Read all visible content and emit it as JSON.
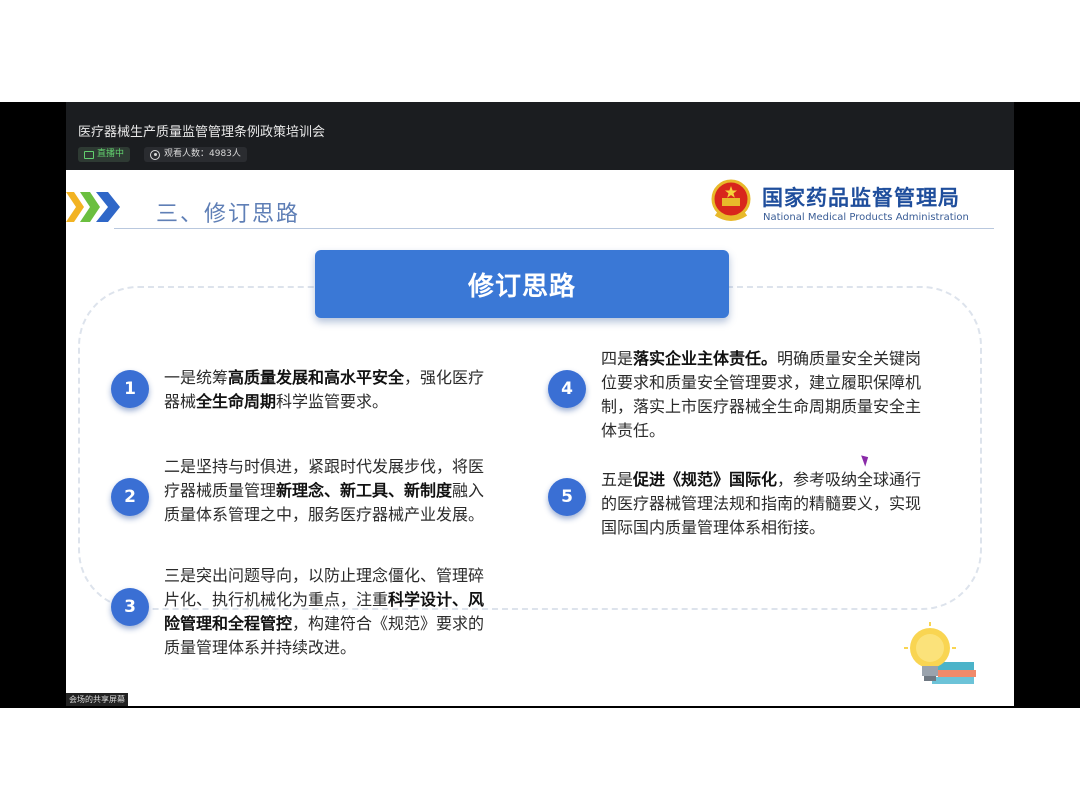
{
  "meeting": {
    "title": "医疗器械生产质量监管管理条例政策培训会",
    "live_label": "直播中",
    "viewers_label": "观看人数：4983人",
    "share_label": "会场的共享屏幕"
  },
  "slide": {
    "section_title": "三、修订思路",
    "logo_cn": "国家药品监督管理局",
    "logo_en": "National Medical Products Administration",
    "banner": "修订思路",
    "items": [
      {
        "num": "1",
        "segments": [
          {
            "t": "一是统筹",
            "b": false
          },
          {
            "t": "高质量发展和高水平安全",
            "b": true
          },
          {
            "t": "，强化医疗器械",
            "b": false
          },
          {
            "t": "全生命周期",
            "b": true
          },
          {
            "t": "科学监管要求。",
            "b": false
          }
        ]
      },
      {
        "num": "2",
        "segments": [
          {
            "t": "二是坚持与时俱进，紧跟时代发展步伐，将医疗器械质量管理",
            "b": false
          },
          {
            "t": "新理念、新工具、新制度",
            "b": true
          },
          {
            "t": "融入质量体系管理之中，服务医疗器械产业发展。",
            "b": false
          }
        ]
      },
      {
        "num": "3",
        "segments": [
          {
            "t": "三是突出问题导向，以防止理念僵化、管理碎片化、执行机械化为重点，注重",
            "b": false
          },
          {
            "t": "科学设计、风险管理和全程管控",
            "b": true
          },
          {
            "t": "，构建符合《规范》要求的质量管理体系并持续改进。",
            "b": false
          }
        ]
      },
      {
        "num": "4",
        "segments": [
          {
            "t": "四是",
            "b": false
          },
          {
            "t": "落实企业主体责任。",
            "b": true
          },
          {
            "t": "明确质量安全关键岗位要求和质量安全管理要求，建立履职保障机制，落实上市医疗器械全生命周期质量安全主体责任。",
            "b": false
          }
        ]
      },
      {
        "num": "5",
        "segments": [
          {
            "t": "五是",
            "b": false
          },
          {
            "t": "促进《规范》国际化",
            "b": true
          },
          {
            "t": "，参考吸纳全球通行的医疗器械管理法规和指南的精髓要义，实现国际国内质量管理体系相衔接。",
            "b": false
          }
        ]
      }
    ]
  },
  "colors": {
    "accent_blue": "#3a78d6",
    "badge_blue": "#3a6fd4",
    "logo_blue": "#1f4e9c",
    "live_green": "#62d06e",
    "chevron_yellow": "#f2b322",
    "chevron_green": "#6bbf3f",
    "chevron_blue": "#2f67c8"
  },
  "icons": [
    "video-camera-icon",
    "eye-icon",
    "chevron-arrows-icon",
    "national-emblem-icon",
    "lightbulb-icon",
    "mouse-cursor-icon"
  ]
}
